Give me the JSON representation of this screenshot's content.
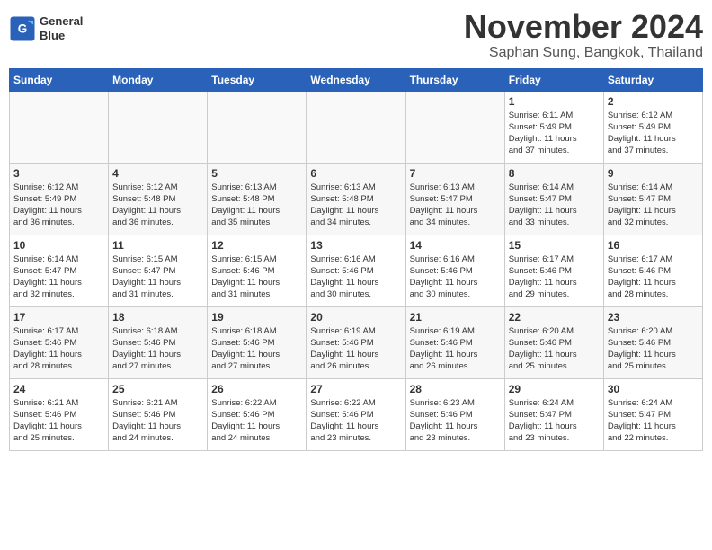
{
  "header": {
    "logo_line1": "General",
    "logo_line2": "Blue",
    "month": "November 2024",
    "location": "Saphan Sung, Bangkok, Thailand"
  },
  "weekdays": [
    "Sunday",
    "Monday",
    "Tuesday",
    "Wednesday",
    "Thursday",
    "Friday",
    "Saturday"
  ],
  "weeks": [
    [
      {
        "day": "",
        "info": ""
      },
      {
        "day": "",
        "info": ""
      },
      {
        "day": "",
        "info": ""
      },
      {
        "day": "",
        "info": ""
      },
      {
        "day": "",
        "info": ""
      },
      {
        "day": "1",
        "info": "Sunrise: 6:11 AM\nSunset: 5:49 PM\nDaylight: 11 hours\nand 37 minutes."
      },
      {
        "day": "2",
        "info": "Sunrise: 6:12 AM\nSunset: 5:49 PM\nDaylight: 11 hours\nand 37 minutes."
      }
    ],
    [
      {
        "day": "3",
        "info": "Sunrise: 6:12 AM\nSunset: 5:49 PM\nDaylight: 11 hours\nand 36 minutes."
      },
      {
        "day": "4",
        "info": "Sunrise: 6:12 AM\nSunset: 5:48 PM\nDaylight: 11 hours\nand 36 minutes."
      },
      {
        "day": "5",
        "info": "Sunrise: 6:13 AM\nSunset: 5:48 PM\nDaylight: 11 hours\nand 35 minutes."
      },
      {
        "day": "6",
        "info": "Sunrise: 6:13 AM\nSunset: 5:48 PM\nDaylight: 11 hours\nand 34 minutes."
      },
      {
        "day": "7",
        "info": "Sunrise: 6:13 AM\nSunset: 5:47 PM\nDaylight: 11 hours\nand 34 minutes."
      },
      {
        "day": "8",
        "info": "Sunrise: 6:14 AM\nSunset: 5:47 PM\nDaylight: 11 hours\nand 33 minutes."
      },
      {
        "day": "9",
        "info": "Sunrise: 6:14 AM\nSunset: 5:47 PM\nDaylight: 11 hours\nand 32 minutes."
      }
    ],
    [
      {
        "day": "10",
        "info": "Sunrise: 6:14 AM\nSunset: 5:47 PM\nDaylight: 11 hours\nand 32 minutes."
      },
      {
        "day": "11",
        "info": "Sunrise: 6:15 AM\nSunset: 5:47 PM\nDaylight: 11 hours\nand 31 minutes."
      },
      {
        "day": "12",
        "info": "Sunrise: 6:15 AM\nSunset: 5:46 PM\nDaylight: 11 hours\nand 31 minutes."
      },
      {
        "day": "13",
        "info": "Sunrise: 6:16 AM\nSunset: 5:46 PM\nDaylight: 11 hours\nand 30 minutes."
      },
      {
        "day": "14",
        "info": "Sunrise: 6:16 AM\nSunset: 5:46 PM\nDaylight: 11 hours\nand 30 minutes."
      },
      {
        "day": "15",
        "info": "Sunrise: 6:17 AM\nSunset: 5:46 PM\nDaylight: 11 hours\nand 29 minutes."
      },
      {
        "day": "16",
        "info": "Sunrise: 6:17 AM\nSunset: 5:46 PM\nDaylight: 11 hours\nand 28 minutes."
      }
    ],
    [
      {
        "day": "17",
        "info": "Sunrise: 6:17 AM\nSunset: 5:46 PM\nDaylight: 11 hours\nand 28 minutes."
      },
      {
        "day": "18",
        "info": "Sunrise: 6:18 AM\nSunset: 5:46 PM\nDaylight: 11 hours\nand 27 minutes."
      },
      {
        "day": "19",
        "info": "Sunrise: 6:18 AM\nSunset: 5:46 PM\nDaylight: 11 hours\nand 27 minutes."
      },
      {
        "day": "20",
        "info": "Sunrise: 6:19 AM\nSunset: 5:46 PM\nDaylight: 11 hours\nand 26 minutes."
      },
      {
        "day": "21",
        "info": "Sunrise: 6:19 AM\nSunset: 5:46 PM\nDaylight: 11 hours\nand 26 minutes."
      },
      {
        "day": "22",
        "info": "Sunrise: 6:20 AM\nSunset: 5:46 PM\nDaylight: 11 hours\nand 25 minutes."
      },
      {
        "day": "23",
        "info": "Sunrise: 6:20 AM\nSunset: 5:46 PM\nDaylight: 11 hours\nand 25 minutes."
      }
    ],
    [
      {
        "day": "24",
        "info": "Sunrise: 6:21 AM\nSunset: 5:46 PM\nDaylight: 11 hours\nand 25 minutes."
      },
      {
        "day": "25",
        "info": "Sunrise: 6:21 AM\nSunset: 5:46 PM\nDaylight: 11 hours\nand 24 minutes."
      },
      {
        "day": "26",
        "info": "Sunrise: 6:22 AM\nSunset: 5:46 PM\nDaylight: 11 hours\nand 24 minutes."
      },
      {
        "day": "27",
        "info": "Sunrise: 6:22 AM\nSunset: 5:46 PM\nDaylight: 11 hours\nand 23 minutes."
      },
      {
        "day": "28",
        "info": "Sunrise: 6:23 AM\nSunset: 5:46 PM\nDaylight: 11 hours\nand 23 minutes."
      },
      {
        "day": "29",
        "info": "Sunrise: 6:24 AM\nSunset: 5:47 PM\nDaylight: 11 hours\nand 23 minutes."
      },
      {
        "day": "30",
        "info": "Sunrise: 6:24 AM\nSunset: 5:47 PM\nDaylight: 11 hours\nand 22 minutes."
      }
    ]
  ]
}
